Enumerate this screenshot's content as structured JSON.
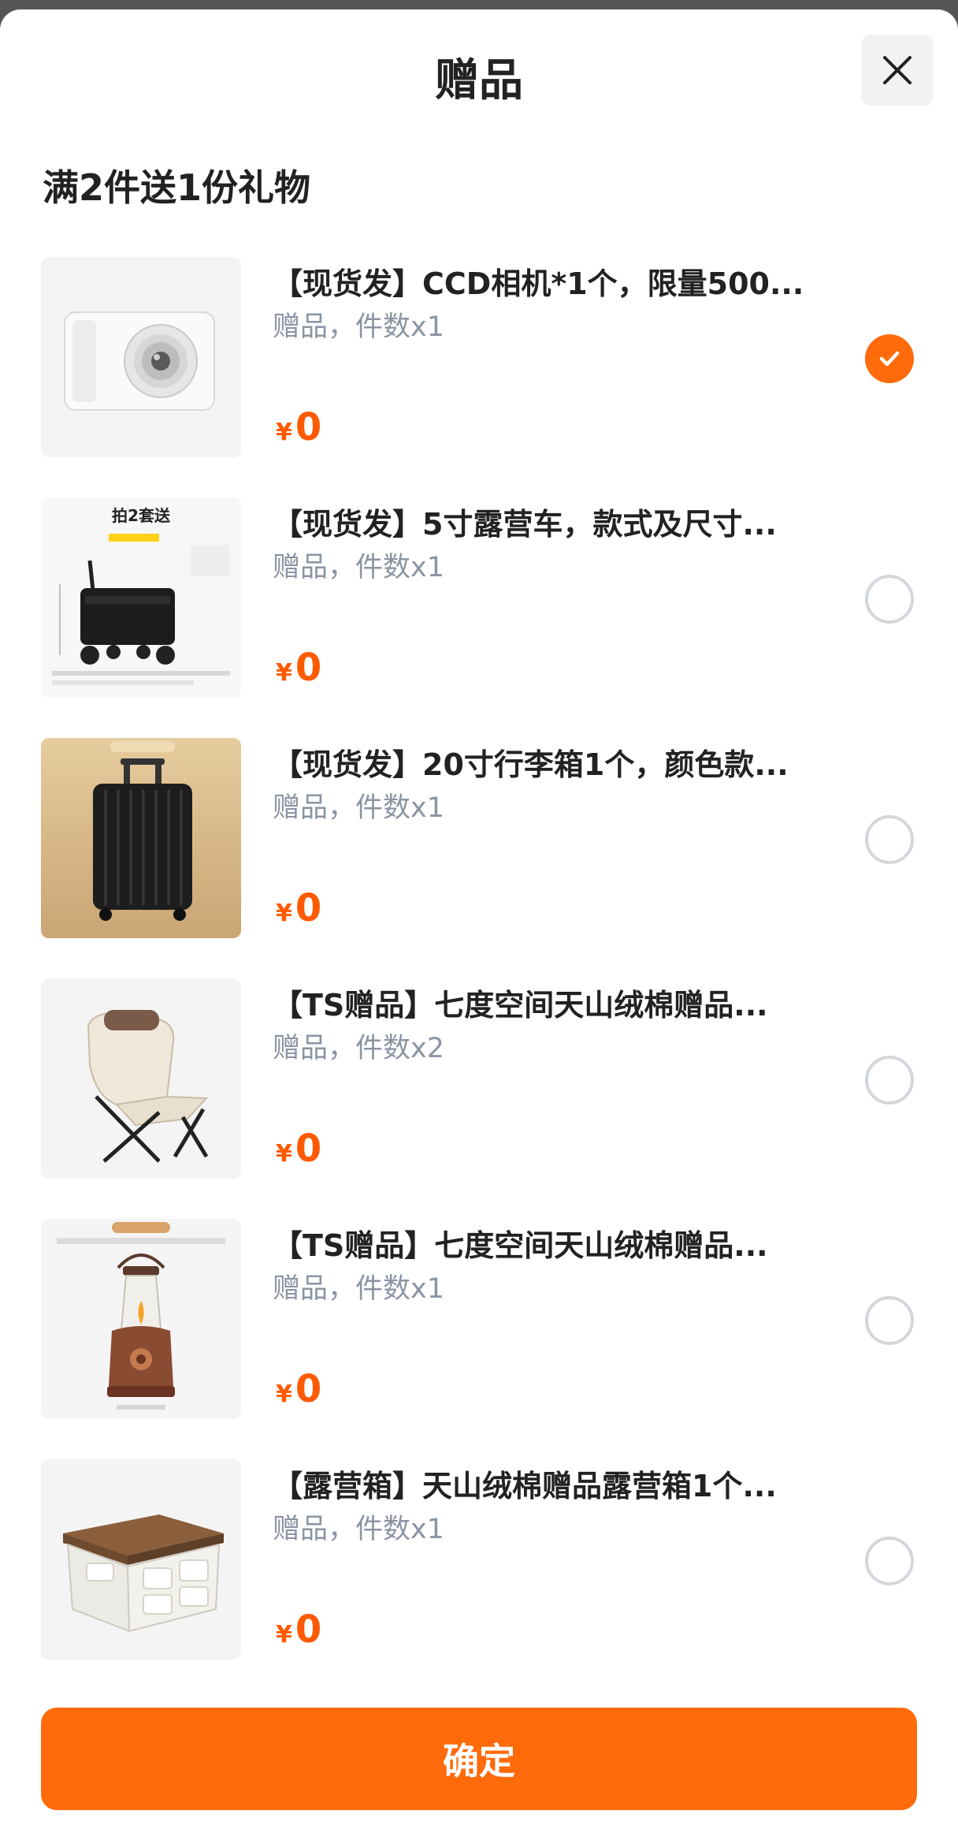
{
  "header": {
    "title": "赠品",
    "close_icon": "close-icon"
  },
  "promo": {
    "label": "满2件送1份礼物"
  },
  "gifts": [
    {
      "name": "【现货发】CCD相机*1个，限量500...",
      "meta": "赠品，件数x1",
      "currency": "¥",
      "price": "0",
      "selected": true,
      "image": "camera-image"
    },
    {
      "name": "【现货发】5寸露营车，款式及尺寸...",
      "meta": "赠品，件数x1",
      "currency": "¥",
      "price": "0",
      "selected": false,
      "image": "camping-cart-image",
      "image_text": {
        "headline": "拍2套送"
      }
    },
    {
      "name": "【现货发】20寸行李箱1个，颜色款...",
      "meta": "赠品，件数x1",
      "currency": "¥",
      "price": "0",
      "selected": false,
      "image": "suitcase-image"
    },
    {
      "name": "【TS赠品】七度空间天山绒棉赠品...",
      "meta": "赠品，件数x2",
      "currency": "¥",
      "price": "0",
      "selected": false,
      "image": "camping-chair-image"
    },
    {
      "name": "【TS赠品】七度空间天山绒棉赠品...",
      "meta": "赠品，件数x1",
      "currency": "¥",
      "price": "0",
      "selected": false,
      "image": "oil-lantern-image"
    },
    {
      "name": "【露营箱】天山绒棉赠品露营箱1个...",
      "meta": "赠品，件数x1",
      "currency": "¥",
      "price": "0",
      "selected": false,
      "image": "storage-box-image"
    }
  ],
  "footer": {
    "confirm_label": "确定"
  },
  "colors": {
    "accent": "#ff6a0a",
    "price": "#ff5a00",
    "meta_text": "#8a94a3"
  }
}
